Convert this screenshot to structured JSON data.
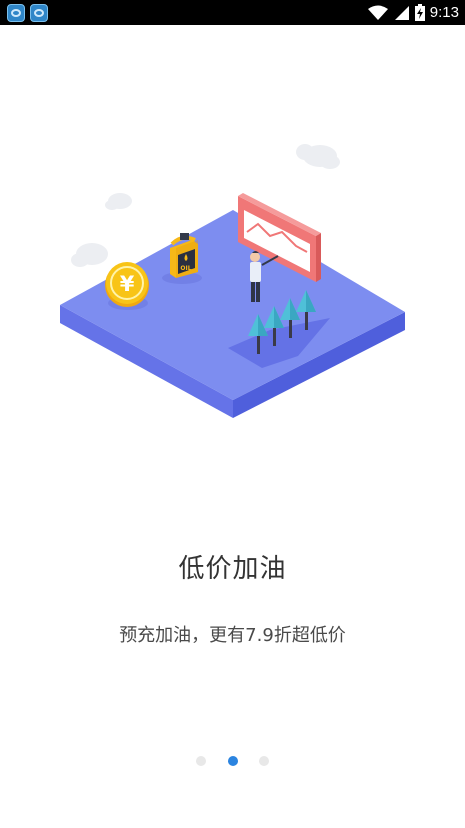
{
  "status_bar": {
    "time": "9:13",
    "notification_icons": [
      "app-icon",
      "app-icon"
    ],
    "indicators": [
      "wifi-icon",
      "signal-icon",
      "battery-icon"
    ]
  },
  "onboarding": {
    "illustration_icons": [
      "cloud-icon",
      "yuan-coin-icon",
      "oil-can-icon",
      "oil-label",
      "chart-board-icon",
      "presenter-person",
      "tree-icon"
    ],
    "oil_label": "OIL",
    "coin_symbol": "¥",
    "title": "低价加油",
    "subtitle": "预充加油，更有7.9折超低价",
    "page_indicator": {
      "total": 3,
      "current": 2
    }
  },
  "colors": {
    "accent": "#2b84e0",
    "platform_top": "#7d8df0",
    "platform_side": "#5564e0",
    "board": "#f28a8a",
    "coin": "#f8c417",
    "tree": "#4fc0d8"
  }
}
